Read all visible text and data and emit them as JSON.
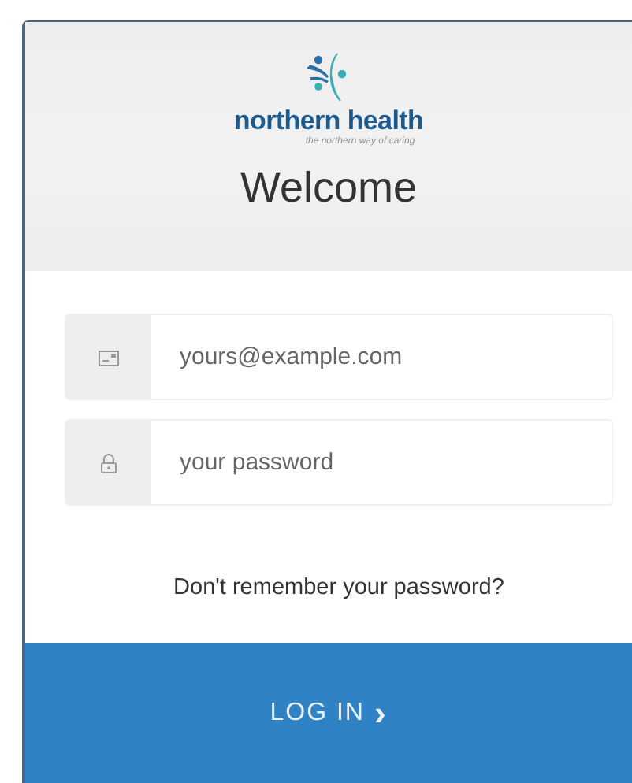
{
  "logo": {
    "name": "northern health",
    "tagline": "the northern way of caring"
  },
  "title": "Welcome",
  "fields": [
    {
      "kind": "email",
      "placeholder": "yours@example.com"
    },
    {
      "kind": "password",
      "placeholder": "your password"
    }
  ],
  "forgot_link": "Don't remember your password?",
  "login_button": {
    "label": "LOG IN",
    "arrow": "›"
  }
}
